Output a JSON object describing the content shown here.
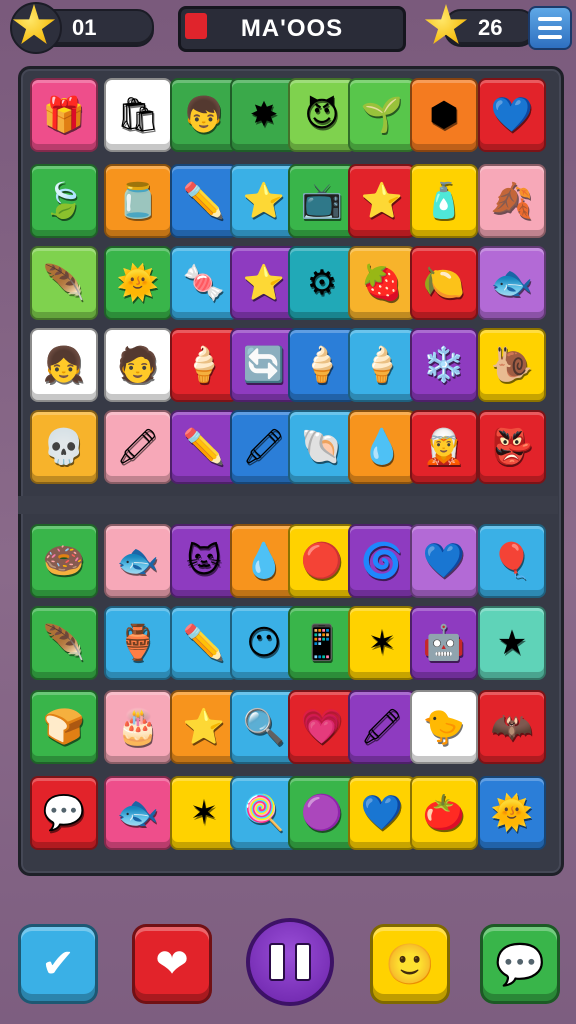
{
  "hud": {
    "left_counter": "01",
    "title": "MA'OOS",
    "right_counter": "26"
  },
  "board": {
    "rows": [
      [
        {
          "icon": "gift-box",
          "glyph": "🎁",
          "bg": "#ee4e8b"
        },
        {
          "icon": "shopping-bag",
          "glyph": "🛍",
          "bg": "#ffffff"
        },
        {
          "icon": "boy-face",
          "glyph": "👦",
          "bg": "#3aa94a"
        },
        {
          "icon": "red-splat",
          "glyph": "✸",
          "bg": "#3aa94a"
        },
        {
          "icon": "devil-face",
          "glyph": "😈",
          "bg": "#7fd24e"
        },
        {
          "icon": "leaf-sprout",
          "glyph": "🌱",
          "bg": "#58c64b"
        },
        {
          "icon": "cube-shield",
          "glyph": "⬢",
          "bg": "#f47b20"
        },
        {
          "icon": "heart",
          "glyph": "💙",
          "bg": "#e2232a"
        }
      ],
      [
        {
          "icon": "blue-leaf",
          "glyph": "🍃",
          "bg": "#39b54a"
        },
        {
          "icon": "tiki-jar",
          "glyph": "🫙",
          "bg": "#f7941d"
        },
        {
          "icon": "pencil",
          "glyph": "✏️",
          "bg": "#2b7ed8"
        },
        {
          "icon": "orange-star",
          "glyph": "⭐",
          "bg": "#3ab0e6"
        },
        {
          "icon": "tv-screen",
          "glyph": "📺",
          "bg": "#39b54a"
        },
        {
          "icon": "gold-star",
          "glyph": "⭐",
          "bg": "#e2232a"
        },
        {
          "icon": "purple-bottle",
          "glyph": "🧴",
          "bg": "#ffd200"
        },
        {
          "icon": "green-leaf",
          "glyph": "🍂",
          "bg": "#f7a8b8"
        }
      ],
      [
        {
          "icon": "feather",
          "glyph": "🪶",
          "bg": "#7fd24e"
        },
        {
          "icon": "sun",
          "glyph": "🌞",
          "bg": "#39b54a"
        },
        {
          "icon": "purple-candy",
          "glyph": "🍬",
          "bg": "#3ab0e6"
        },
        {
          "icon": "yellow-star",
          "glyph": "⭐",
          "bg": "#8e3bc0"
        },
        {
          "icon": "red-gear",
          "glyph": "⚙",
          "bg": "#21a9b7"
        },
        {
          "icon": "jam-jar",
          "glyph": "🍓",
          "bg": "#f7b32b"
        },
        {
          "icon": "lemon",
          "glyph": "🍋",
          "bg": "#e2232a"
        },
        {
          "icon": "blue-fish",
          "glyph": "🐟",
          "bg": "#b36ad6"
        }
      ],
      [
        {
          "icon": "girl-face",
          "glyph": "👧",
          "bg": "#ffffff"
        },
        {
          "icon": "bald-face",
          "glyph": "🧑",
          "bg": "#ffffff"
        },
        {
          "icon": "cotton-candy",
          "glyph": "🍦",
          "bg": "#e2232a"
        },
        {
          "icon": "green-ring",
          "glyph": "🔄",
          "bg": "#8e3bc0"
        },
        {
          "icon": "ice-cream-cone",
          "glyph": "🍦",
          "bg": "#2b7ed8"
        },
        {
          "icon": "ice-cream-cone",
          "glyph": "🍦",
          "bg": "#3ab0e6"
        },
        {
          "icon": "snowflake",
          "glyph": "❄️",
          "bg": "#8e3bc0"
        },
        {
          "icon": "green-slug",
          "glyph": "🐌",
          "bg": "#ffd200"
        }
      ],
      [
        {
          "icon": "yellow-skull",
          "glyph": "💀",
          "bg": "#f7b32b"
        },
        {
          "icon": "green-crayon",
          "glyph": "🖍",
          "bg": "#f7a8b8"
        },
        {
          "icon": "yellow-pencil",
          "glyph": "✏️",
          "bg": "#8e3bc0"
        },
        {
          "icon": "green-crayon",
          "glyph": "🖍",
          "bg": "#2b7ed8"
        },
        {
          "icon": "purple-shell",
          "glyph": "🐚",
          "bg": "#3ab0e6"
        },
        {
          "icon": "pink-drop",
          "glyph": "💧",
          "bg": "#f7941d"
        },
        {
          "icon": "elf-face",
          "glyph": "🧝",
          "bg": "#e2232a"
        },
        {
          "icon": "orange-mask",
          "glyph": "👺",
          "bg": "#e2232a"
        }
      ],
      [
        {
          "icon": "donut",
          "glyph": "🍩",
          "bg": "#39b54a"
        },
        {
          "icon": "blue-fish",
          "glyph": "🐟",
          "bg": "#f7a8b8"
        },
        {
          "icon": "white-cat",
          "glyph": "🐱",
          "bg": "#8e3bc0"
        },
        {
          "icon": "pink-drop",
          "glyph": "💧",
          "bg": "#f7941d"
        },
        {
          "icon": "red-ball",
          "glyph": "🔴",
          "bg": "#ffd200"
        },
        {
          "icon": "swirl",
          "glyph": "🌀",
          "bg": "#8e3bc0"
        },
        {
          "icon": "blue-heart",
          "glyph": "💙",
          "bg": "#b36ad6"
        },
        {
          "icon": "red-balloon",
          "glyph": "🎈",
          "bg": "#3ab0e6"
        }
      ],
      [
        {
          "icon": "blue-feather",
          "glyph": "🪶",
          "bg": "#39b54a"
        },
        {
          "icon": "jar",
          "glyph": "🏺",
          "bg": "#3ab0e6"
        },
        {
          "icon": "pencil",
          "glyph": "✏️",
          "bg": "#3ab0e6"
        },
        {
          "icon": "orange-face",
          "glyph": "😶",
          "bg": "#3ab0e6"
        },
        {
          "icon": "tablet",
          "glyph": "📱",
          "bg": "#39b54a"
        },
        {
          "icon": "red-starfish",
          "glyph": "✶",
          "bg": "#ffd200"
        },
        {
          "icon": "robot",
          "glyph": "🤖",
          "bg": "#8e3bc0"
        },
        {
          "icon": "red-star",
          "glyph": "★",
          "bg": "#5fd3b8"
        }
      ],
      [
        {
          "icon": "toaster",
          "glyph": "🍞",
          "bg": "#39b54a"
        },
        {
          "icon": "cake-slice",
          "glyph": "🎂",
          "bg": "#f7a8b8"
        },
        {
          "icon": "star-badge",
          "glyph": "⭐",
          "bg": "#f7941d"
        },
        {
          "icon": "magnifier",
          "glyph": "🔍",
          "bg": "#3ab0e6"
        },
        {
          "icon": "heart-ring",
          "glyph": "💗",
          "bg": "#e2232a"
        },
        {
          "icon": "crayons",
          "glyph": "🖍",
          "bg": "#8e3bc0"
        },
        {
          "icon": "yellow-bird",
          "glyph": "🐤",
          "bg": "#ffffff"
        },
        {
          "icon": "white-bat",
          "glyph": "🦇",
          "bg": "#e2232a"
        }
      ],
      [
        {
          "icon": "speech-bubble",
          "glyph": "💬",
          "bg": "#e2232a"
        },
        {
          "icon": "blue-fish",
          "glyph": "🐟",
          "bg": "#ee4e8b"
        },
        {
          "icon": "red-starfish",
          "glyph": "✶",
          "bg": "#ffd200"
        },
        {
          "icon": "popsicle",
          "glyph": "🍭",
          "bg": "#3ab0e6"
        },
        {
          "icon": "purple-blob",
          "glyph": "🟣",
          "bg": "#39b54a"
        },
        {
          "icon": "blue-heart",
          "glyph": "💙",
          "bg": "#ffd200"
        },
        {
          "icon": "tomato",
          "glyph": "🍅",
          "bg": "#ffd200"
        },
        {
          "icon": "sun-face",
          "glyph": "🌞",
          "bg": "#2b7ed8"
        }
      ]
    ]
  },
  "bottom_bar": {
    "buttons": [
      {
        "name": "check-button",
        "icon": "check-icon",
        "glyph": "✔",
        "bg": "#3ab0e6"
      },
      {
        "name": "heart-button",
        "icon": "heart-icon",
        "glyph": "❤",
        "bg": "#e2232a"
      },
      {
        "name": "face-button",
        "icon": "face-icon",
        "glyph": "🙂",
        "bg": "#ffd200"
      },
      {
        "name": "chat-button",
        "icon": "chat-bubble-icon",
        "glyph": "💬",
        "bg": "#39b54a"
      }
    ]
  }
}
